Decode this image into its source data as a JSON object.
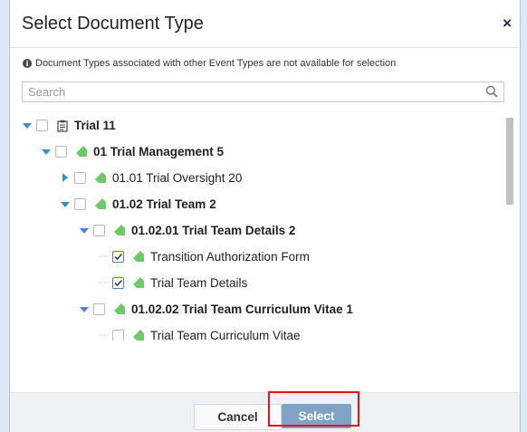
{
  "dialog": {
    "title": "Select Document Type",
    "close_symbol": "×",
    "info_text": "Document Types associated with other Event Types are not available for selection"
  },
  "search": {
    "placeholder": "Search",
    "icon": "search-icon"
  },
  "tree": [
    {
      "label": "Trial 11",
      "level": 0,
      "expanded": true,
      "checked": false,
      "icon": "clipboard-icon",
      "bold": true
    },
    {
      "label": "01 Trial Management 5",
      "level": 1,
      "expanded": true,
      "checked": false,
      "icon": "tag-icon",
      "bold": true
    },
    {
      "label": "01.01 Trial Oversight 20",
      "level": 2,
      "expanded": false,
      "checked": false,
      "icon": "tag-icon",
      "bold": false
    },
    {
      "label": "01.02 Trial Team 2",
      "level": 2,
      "expanded": true,
      "checked": false,
      "icon": "tag-icon",
      "bold": true
    },
    {
      "label": "01.02.01 Trial Team Details 2",
      "level": 3,
      "expanded": true,
      "checked": false,
      "icon": "tag-icon",
      "bold": true
    },
    {
      "label": "Transition Authorization Form",
      "level": 4,
      "leaf": true,
      "checked": true,
      "icon": "tag-icon",
      "bold": false
    },
    {
      "label": "Trial Team Details",
      "level": 4,
      "leaf": true,
      "checked": true,
      "icon": "tag-icon",
      "bold": false
    },
    {
      "label": "01.02.02 Trial Team Curriculum Vitae 1",
      "level": 3,
      "expanded": true,
      "checked": false,
      "icon": "tag-icon",
      "bold": true
    },
    {
      "label": "Trial Team Curriculum Vitae",
      "level": 4,
      "leaf": true,
      "checked": false,
      "icon": "tag-icon",
      "bold": false
    }
  ],
  "footer": {
    "cancel_label": "Cancel",
    "select_label": "Select"
  },
  "colors": {
    "caret": "#3d8ad0",
    "tag": "#6fc96a",
    "select_button": "#7fa2c5",
    "highlight": "#e0141c"
  }
}
